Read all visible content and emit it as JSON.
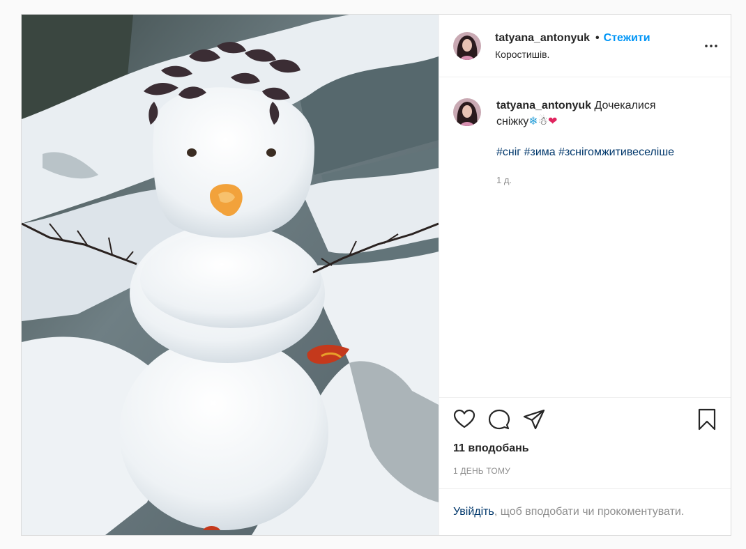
{
  "post": {
    "username": "tatyana_antonyuk",
    "separator": "•",
    "follow_label": "Стежити",
    "location": "Коростишів.",
    "more_icon": "more-horizontal-icon",
    "caption": {
      "username": "tatyana_antonyuk",
      "text_part1": "Дочекалися",
      "text_part2": "сніжку",
      "emoji": [
        "❄",
        "☃",
        "❤"
      ],
      "hashtags": [
        "#сніг",
        "#зима",
        "#зснігомжитивеселіше"
      ],
      "time": "1 д."
    },
    "actions": {
      "like_icon": "heart-icon",
      "comment_icon": "comment-icon",
      "share_icon": "paper-plane-icon",
      "save_icon": "bookmark-icon"
    },
    "likes": "11 вподобань",
    "time_ago": "1 день тому",
    "login_link": "Увійдіть",
    "login_text": ", щоб вподобати чи прокоментувати."
  },
  "colors": {
    "follow": "#0095f6",
    "hashtag": "#00376b",
    "muted": "#8e8e8e",
    "border": "#dbdbdb"
  }
}
